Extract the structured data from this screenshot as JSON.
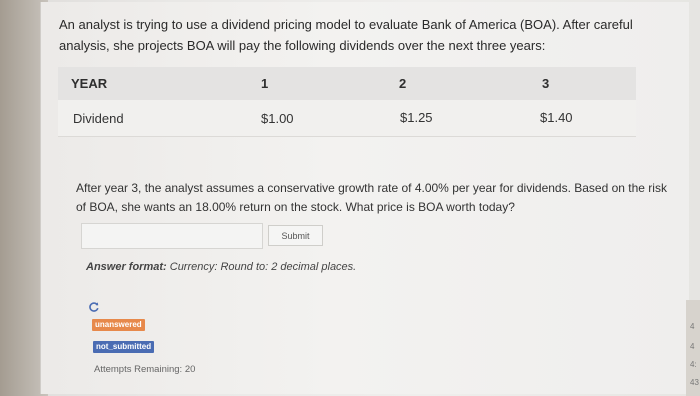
{
  "intro_text": "An analyst is trying to use a dividend pricing model to evaluate Bank of America (BOA). After careful analysis, she projects BOA will pay the following dividends over the next three years:",
  "table": {
    "header": [
      "YEAR",
      "1",
      "2",
      "3"
    ],
    "row": [
      "Dividend",
      "$1.00",
      "$1.25",
      "$1.40"
    ]
  },
  "question_text": "After year 3, the analyst assumes a conservative growth rate of 4.00% per year for dividends. Based on the risk of BOA, she wants an 18.00% return on the stock. What price is BOA worth today?",
  "answer": {
    "value": ""
  },
  "submit_label": "Submit",
  "answer_format": {
    "label": "Answer format:",
    "text": "Currency: Round to: 2 decimal places."
  },
  "status": {
    "unanswered": "unanswered",
    "not_submitted": "not_submitted",
    "attempts": "Attempts Remaining: 20"
  },
  "edge_numbers": [
    "4",
    "4",
    "4:",
    "43"
  ],
  "icons": {
    "refresh": "refresh-icon"
  }
}
